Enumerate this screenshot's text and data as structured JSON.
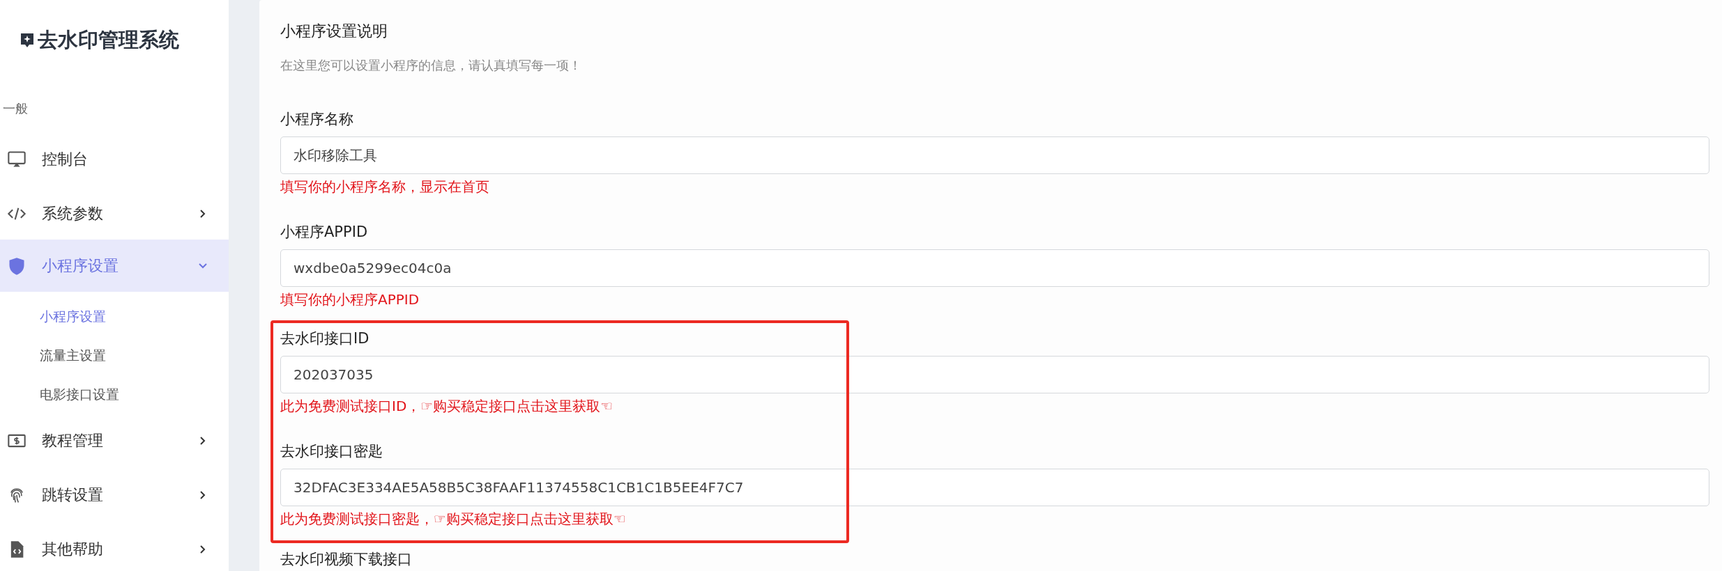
{
  "sidebar": {
    "title": "去水印管理系统",
    "section_label": "一般",
    "items": [
      {
        "label": "控制台",
        "selected": false
      },
      {
        "label": "系统参数",
        "selected": false,
        "expanded": false
      },
      {
        "label": "小程序设置",
        "selected": true,
        "expanded": true,
        "children": [
          {
            "label": "小程序设置",
            "selected": true
          },
          {
            "label": "流量主设置",
            "selected": false
          },
          {
            "label": "电影接口设置",
            "selected": false
          }
        ]
      },
      {
        "label": "教程管理",
        "selected": false,
        "expanded": false
      },
      {
        "label": "跳转设置",
        "selected": false,
        "expanded": false
      },
      {
        "label": "其他帮助",
        "selected": false,
        "expanded": false
      }
    ]
  },
  "form": {
    "title": "小程序设置说明",
    "description": "在这里您可以设置小程序的信息，请认真填写每一项！",
    "groups": [
      {
        "highlighted": false,
        "fields": [
          {
            "label": "小程序名称",
            "value": "水印移除工具",
            "hint": "填写你的小程序名称，显示在首页"
          },
          {
            "label": "小程序APPID",
            "value": "wxdbe0a5299ec04c0a",
            "hint": "填写你的小程序APPID"
          }
        ]
      },
      {
        "highlighted": true,
        "fields": [
          {
            "label": "去水印接口ID",
            "value": "202037035",
            "hint": "此为免费测试接口ID，",
            "hint_link": "☞购买稳定接口点击这里获取☜"
          },
          {
            "label": "去水印接口密匙",
            "value": "32DFAC3E334AE5A58B5C38FAAF11374558C1CB1C1B5EE4F7C7",
            "hint": "此为免费测试接口密匙，",
            "hint_link": "☞购买稳定接口点击这里获取☜"
          }
        ]
      },
      {
        "highlighted": false,
        "fields": [
          {
            "label": "去水印视频下载接口"
          }
        ]
      }
    ]
  }
}
